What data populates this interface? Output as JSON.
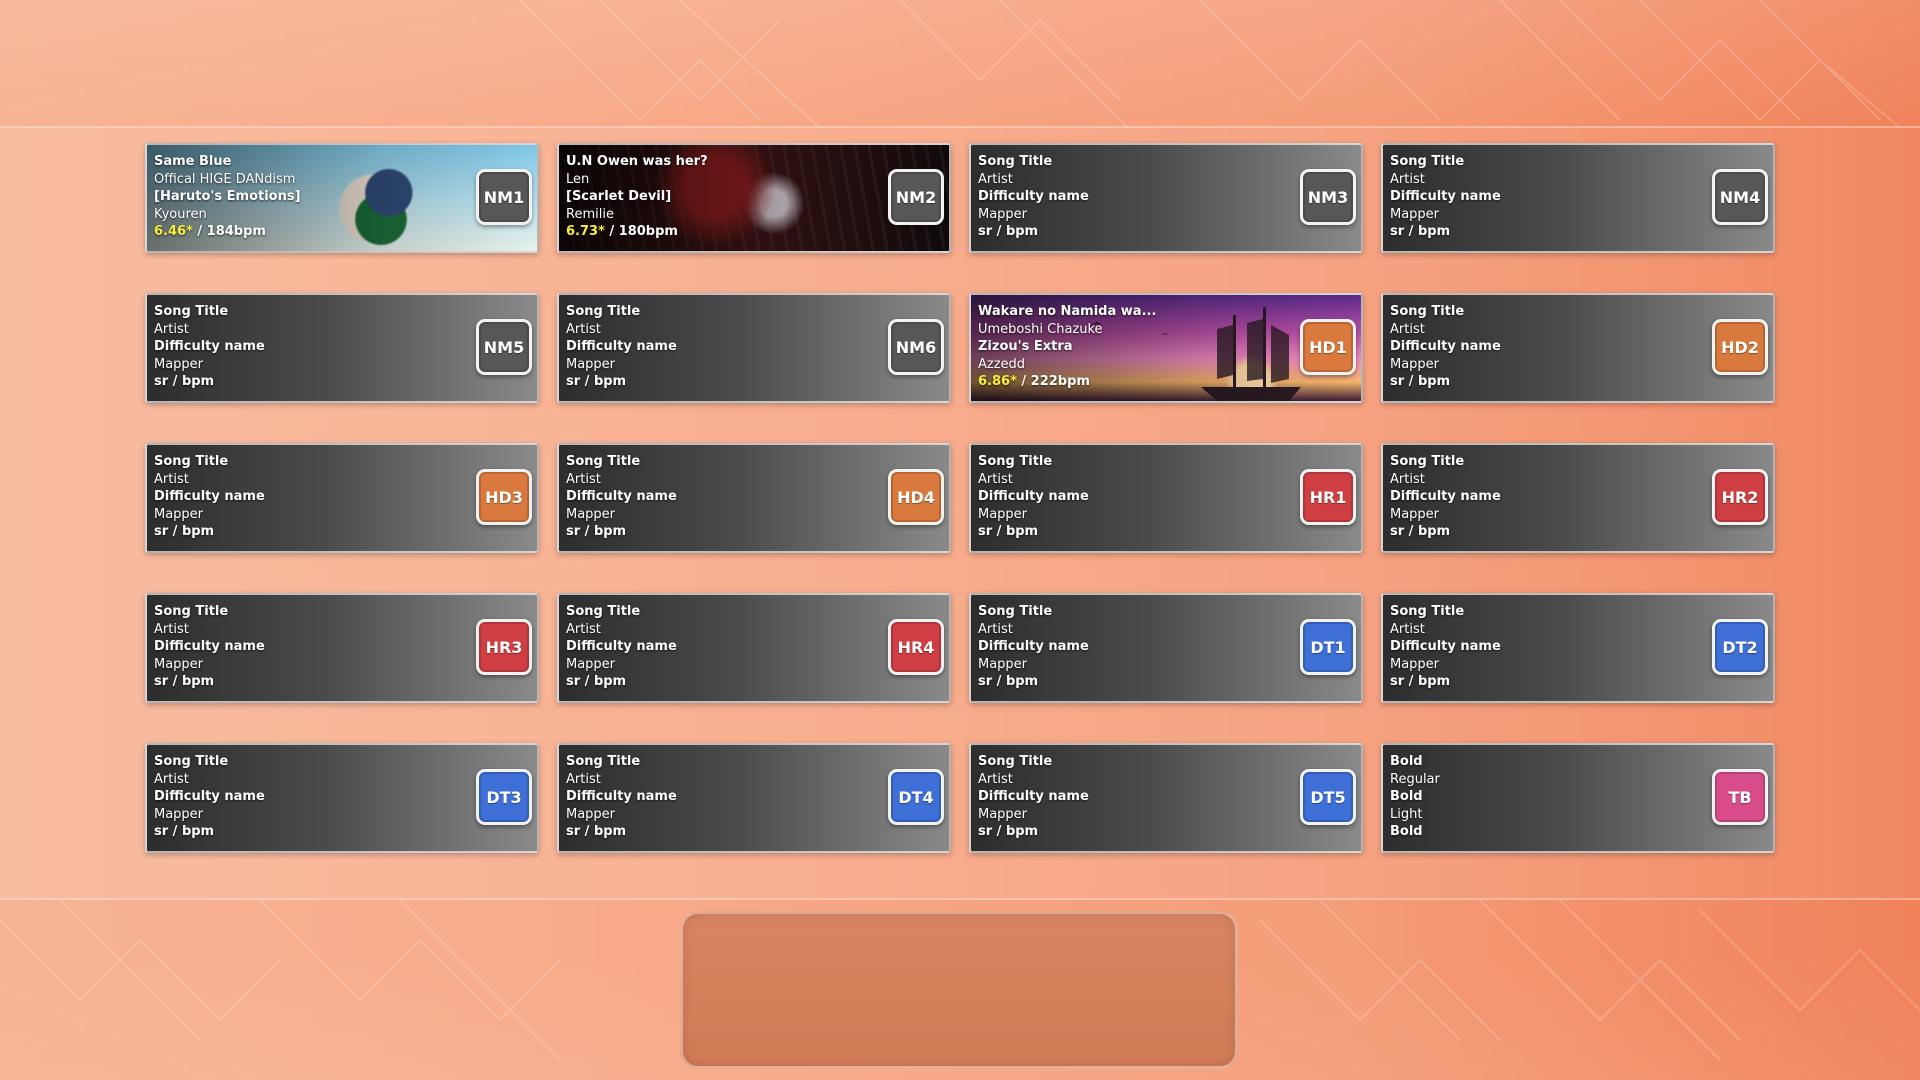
{
  "colors": {
    "NM": "#575757",
    "HD": "#d9793d",
    "HR": "#cf3e43",
    "DT": "#3d6fd6",
    "TB": "#d84d89",
    "sr_highlight": "#f8ee3a"
  },
  "cards": [
    {
      "title": "Same Blue",
      "artist": "Offical HIGE DANdism",
      "difficulty": "[Haruto's Emotions]",
      "mapper": "Kyouren",
      "sr": "6.46*",
      "bpm": " / 184bpm",
      "mod": "NM1",
      "mod_type": "NM",
      "art": "anime-boy-blue-sky-art"
    },
    {
      "title": "U.N Owen was her?",
      "artist": "Len",
      "difficulty": "[Scarlet Devil]",
      "mapper": "Remilie",
      "sr": "6.73*",
      "bpm": " / 180bpm",
      "mod": "NM2",
      "mod_type": "NM",
      "art": "dark-red-gothic-art"
    },
    {
      "title": "Song Title",
      "artist": "Artist",
      "difficulty": "Difficulty name",
      "mapper": "Mapper",
      "sr": "",
      "bpm": "sr / bpm",
      "mod": "NM3",
      "mod_type": "NM",
      "art": ""
    },
    {
      "title": "Song Title",
      "artist": "Artist",
      "difficulty": "Difficulty name",
      "mapper": "Mapper",
      "sr": "",
      "bpm": "sr / bpm",
      "mod": "NM4",
      "mod_type": "NM",
      "art": ""
    },
    {
      "title": "Song Title",
      "artist": "Artist",
      "difficulty": "Difficulty name",
      "mapper": "Mapper",
      "sr": "",
      "bpm": "sr / bpm",
      "mod": "NM5",
      "mod_type": "NM",
      "art": ""
    },
    {
      "title": "Song Title",
      "artist": "Artist",
      "difficulty": "Difficulty name",
      "mapper": "Mapper",
      "sr": "",
      "bpm": "sr / bpm",
      "mod": "NM6",
      "mod_type": "NM",
      "art": ""
    },
    {
      "title": "Wakare no Namida wa...",
      "artist": "Umeboshi Chazuke",
      "difficulty": "Zizou's Extra",
      "mapper": "Azzedd",
      "sr": "6.86*",
      "bpm": " / 222bpm",
      "mod": "HD1",
      "mod_type": "HD",
      "art": "pirate-ship-sunset-art"
    },
    {
      "title": "Song Title",
      "artist": "Artist",
      "difficulty": "Difficulty name",
      "mapper": "Mapper",
      "sr": "",
      "bpm": "sr / bpm",
      "mod": "HD2",
      "mod_type": "HD",
      "art": ""
    },
    {
      "title": "Song Title",
      "artist": "Artist",
      "difficulty": "Difficulty name",
      "mapper": "Mapper",
      "sr": "",
      "bpm": "sr / bpm",
      "mod": "HD3",
      "mod_type": "HD",
      "art": ""
    },
    {
      "title": "Song Title",
      "artist": "Artist",
      "difficulty": "Difficulty name",
      "mapper": "Mapper",
      "sr": "",
      "bpm": "sr / bpm",
      "mod": "HD4",
      "mod_type": "HD",
      "art": ""
    },
    {
      "title": "Song Title",
      "artist": "Artist",
      "difficulty": "Difficulty name",
      "mapper": "Mapper",
      "sr": "",
      "bpm": "sr / bpm",
      "mod": "HR1",
      "mod_type": "HR",
      "art": ""
    },
    {
      "title": "Song Title",
      "artist": "Artist",
      "difficulty": "Difficulty name",
      "mapper": "Mapper",
      "sr": "",
      "bpm": "sr / bpm",
      "mod": "HR2",
      "mod_type": "HR",
      "art": ""
    },
    {
      "title": "Song Title",
      "artist": "Artist",
      "difficulty": "Difficulty name",
      "mapper": "Mapper",
      "sr": "",
      "bpm": "sr / bpm",
      "mod": "HR3",
      "mod_type": "HR",
      "art": ""
    },
    {
      "title": "Song Title",
      "artist": "Artist",
      "difficulty": "Difficulty name",
      "mapper": "Mapper",
      "sr": "",
      "bpm": "sr / bpm",
      "mod": "HR4",
      "mod_type": "HR",
      "art": ""
    },
    {
      "title": "Song Title",
      "artist": "Artist",
      "difficulty": "Difficulty name",
      "mapper": "Mapper",
      "sr": "",
      "bpm": "sr / bpm",
      "mod": "DT1",
      "mod_type": "DT",
      "art": ""
    },
    {
      "title": "Song Title",
      "artist": "Artist",
      "difficulty": "Difficulty name",
      "mapper": "Mapper",
      "sr": "",
      "bpm": "sr / bpm",
      "mod": "DT2",
      "mod_type": "DT",
      "art": ""
    },
    {
      "title": "Song Title",
      "artist": "Artist",
      "difficulty": "Difficulty name",
      "mapper": "Mapper",
      "sr": "",
      "bpm": "sr / bpm",
      "mod": "DT3",
      "mod_type": "DT",
      "art": ""
    },
    {
      "title": "Song Title",
      "artist": "Artist",
      "difficulty": "Difficulty name",
      "mapper": "Mapper",
      "sr": "",
      "bpm": "sr / bpm",
      "mod": "DT4",
      "mod_type": "DT",
      "art": ""
    },
    {
      "title": "Song Title",
      "artist": "Artist",
      "difficulty": "Difficulty name",
      "mapper": "Mapper",
      "sr": "",
      "bpm": "sr / bpm",
      "mod": "DT5",
      "mod_type": "DT",
      "art": ""
    },
    {
      "title": "Bold",
      "artist": "Regular",
      "difficulty": "Bold",
      "mapper": "Light",
      "sr": "",
      "bpm": "Bold",
      "mod": "TB",
      "mod_type": "TB",
      "art": ""
    }
  ]
}
